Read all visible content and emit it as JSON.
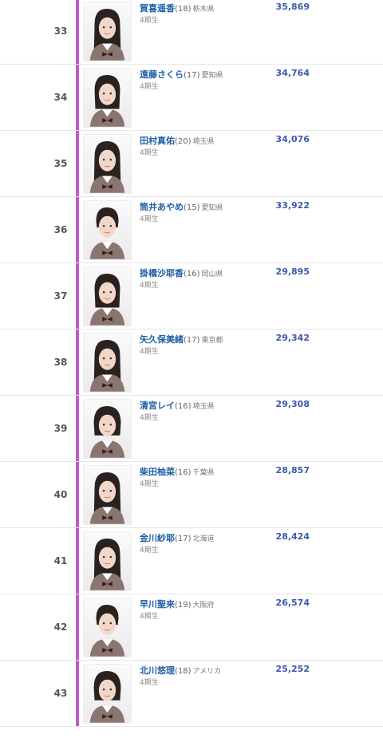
{
  "colors": {
    "rank_bar": "#c25ac9",
    "name": "#1f5fa6",
    "votes": "#3b5aa8"
  },
  "rows": [
    {
      "rank": "33",
      "name": "賀喜遥香",
      "age": "(18)",
      "pref": "栃木県",
      "gen": "4期生",
      "votes": "35,869",
      "hair": "long"
    },
    {
      "rank": "34",
      "name": "遠藤さくら",
      "age": "(17)",
      "pref": "愛知県",
      "gen": "4期生",
      "votes": "34,764",
      "hair": "medium"
    },
    {
      "rank": "35",
      "name": "田村真佑",
      "age": "(20)",
      "pref": "埼玉県",
      "gen": "4期生",
      "votes": "34,076",
      "hair": "long"
    },
    {
      "rank": "36",
      "name": "筒井あやめ",
      "age": "(15)",
      "pref": "愛知県",
      "gen": "4期生",
      "votes": "33,922",
      "hair": "tied"
    },
    {
      "rank": "37",
      "name": "掛橋沙耶香",
      "age": "(16)",
      "pref": "岡山県",
      "gen": "4期生",
      "votes": "29,895",
      "hair": "medium"
    },
    {
      "rank": "38",
      "name": "矢久保美緒",
      "age": "(17)",
      "pref": "東京都",
      "gen": "4期生",
      "votes": "29,342",
      "hair": "long"
    },
    {
      "rank": "39",
      "name": "清宮レイ",
      "age": "(16)",
      "pref": "埼玉県",
      "gen": "4期生",
      "votes": "29,308",
      "hair": "bob"
    },
    {
      "rank": "40",
      "name": "柴田柚菜",
      "age": "(16)",
      "pref": "千葉県",
      "gen": "4期生",
      "votes": "28,857",
      "hair": "long"
    },
    {
      "rank": "41",
      "name": "金川紗耶",
      "age": "(17)",
      "pref": "北海道",
      "gen": "4期生",
      "votes": "28,424",
      "hair": "long"
    },
    {
      "rank": "42",
      "name": "早川聖来",
      "age": "(19)",
      "pref": "大阪府",
      "gen": "4期生",
      "votes": "26,574",
      "hair": "tied"
    },
    {
      "rank": "43",
      "name": "北川悠理",
      "age": "(18)",
      "pref": "アメリカ",
      "gen": "4期生",
      "votes": "25,252",
      "hair": "bob"
    }
  ]
}
